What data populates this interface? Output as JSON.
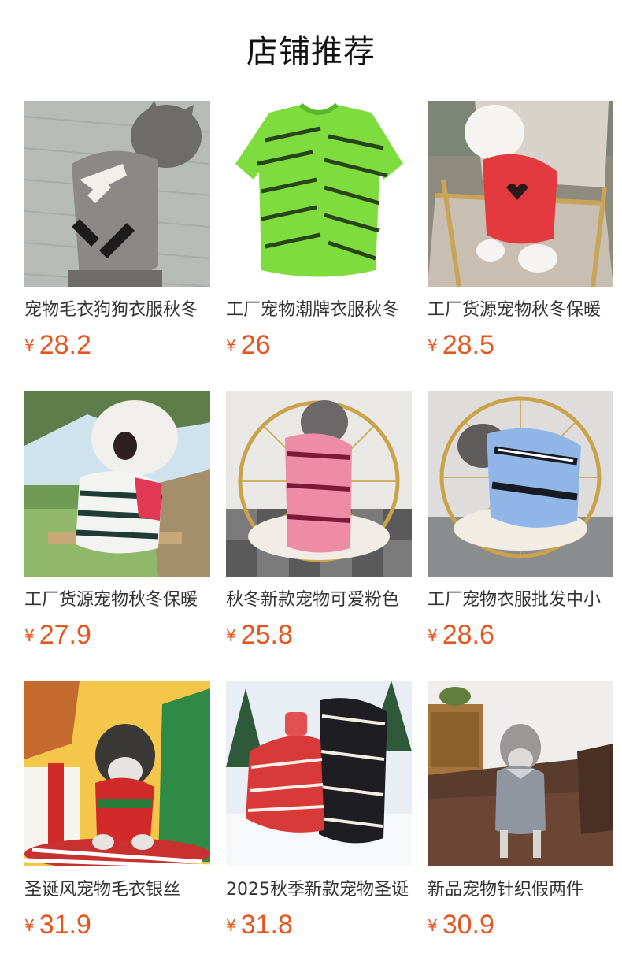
{
  "header": {
    "title": "店铺推荐"
  },
  "currency_symbol": "¥",
  "colors": {
    "price": "#e8541e"
  },
  "products": [
    {
      "name": "宠物毛衣狗狗衣服秋冬",
      "price": "28.2",
      "image": "grey-cat-in-arrow-sweater"
    },
    {
      "name": "工厂宠物潮牌衣服秋冬",
      "price": "26",
      "image": "green-letter-print-sweater"
    },
    {
      "name": "工厂货源宠物秋冬保暖",
      "price": "28.5",
      "image": "white-dog-in-red-heart-sweater-on-chair"
    },
    {
      "name": "工厂货源宠物秋冬保暖",
      "price": "27.9",
      "image": "white-dog-in-striped-sweater-outdoors"
    },
    {
      "name": "秋冬新款宠物可爱粉色",
      "price": "25.8",
      "image": "grey-cat-in-pink-sweater-on-gold-chair"
    },
    {
      "name": "工厂宠物衣服批发中小",
      "price": "28.6",
      "image": "grey-cat-in-blue-sweater-on-gold-chair"
    },
    {
      "name": "圣诞风宠物毛衣银丝",
      "price": "31.9",
      "image": "schnauzer-in-christmas-sweater"
    },
    {
      "name": "2025秋季新款宠物圣诞",
      "price": "31.8",
      "image": "red-and-black-christmas-sweaters-on-snow"
    },
    {
      "name": "新品宠物针织假两件",
      "price": "30.9",
      "image": "schnauzer-in-grey-sweater-on-sofa"
    }
  ]
}
